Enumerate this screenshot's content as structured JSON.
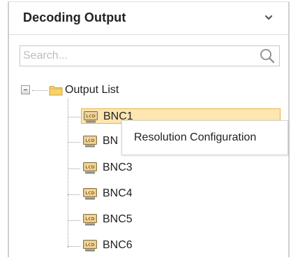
{
  "panel": {
    "title": "Decoding Output",
    "collapse_icon": "chevron-down-icon"
  },
  "search": {
    "placeholder": "Search...",
    "value": "",
    "icon": "search-icon"
  },
  "tree": {
    "root": {
      "label": "Output List",
      "icon": "folder-icon",
      "expanded": true
    },
    "items": [
      {
        "label": "BNC1",
        "icon": "lcd-monitor-icon",
        "selected": true
      },
      {
        "label": "BN",
        "icon": "lcd-monitor-icon",
        "selected": false
      },
      {
        "label": "BNC3",
        "icon": "lcd-monitor-icon",
        "selected": false
      },
      {
        "label": "BNC4",
        "icon": "lcd-monitor-icon",
        "selected": false
      },
      {
        "label": "BNC5",
        "icon": "lcd-monitor-icon",
        "selected": false
      },
      {
        "label": "BNC6",
        "icon": "lcd-monitor-icon",
        "selected": false
      }
    ]
  },
  "context_menu": {
    "items": [
      {
        "label": "Resolution Configuration"
      }
    ]
  },
  "colors": {
    "selected_bg": "#fde6b0",
    "selected_border": "#e9b24a",
    "folder": "#f3c64b",
    "text": "#222222"
  }
}
